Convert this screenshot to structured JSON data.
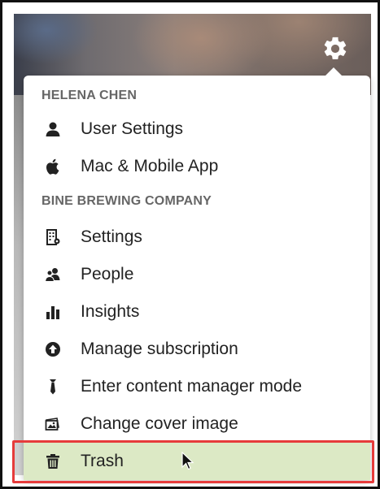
{
  "sections": [
    {
      "header": "HELENA CHEN",
      "items": [
        {
          "label": "User Settings",
          "icon": "user-icon"
        },
        {
          "label": "Mac & Mobile App",
          "icon": "apple-icon"
        }
      ]
    },
    {
      "header": "BINE BREWING COMPANY",
      "items": [
        {
          "label": "Settings",
          "icon": "building-icon"
        },
        {
          "label": "People",
          "icon": "people-icon"
        },
        {
          "label": "Insights",
          "icon": "bar-chart-icon"
        },
        {
          "label": "Manage subscription",
          "icon": "upload-circle-icon"
        },
        {
          "label": "Enter content manager mode",
          "icon": "tie-icon"
        },
        {
          "label": "Change cover image",
          "icon": "image-icon"
        },
        {
          "label": "Trash",
          "icon": "trash-icon"
        }
      ]
    }
  ],
  "colors": {
    "highlight_fill": "#dce9c5",
    "highlight_border": "#e63b3b",
    "header_text": "#666666",
    "item_text": "#222222"
  }
}
